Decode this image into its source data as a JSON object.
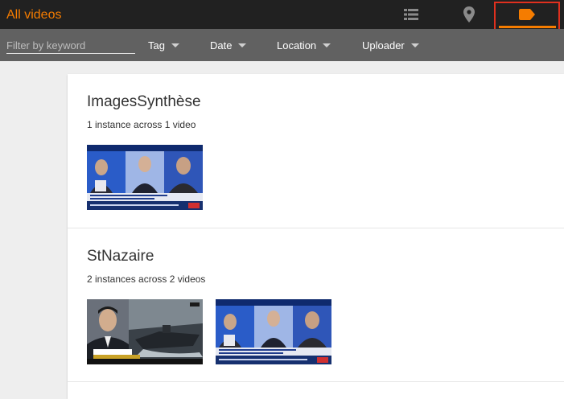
{
  "header": {
    "title": "All videos",
    "views": [
      {
        "name": "list-view",
        "icon": "list-icon"
      },
      {
        "name": "map-view",
        "icon": "map-pin-icon"
      },
      {
        "name": "tag-view",
        "icon": "tag-icon",
        "active": true
      }
    ],
    "accent_color": "#f57c00"
  },
  "filters": {
    "keyword_placeholder": "Filter by keyword",
    "keyword_value": "",
    "dropdowns": [
      "Tag",
      "Date",
      "Location",
      "Uploader"
    ]
  },
  "groups": [
    {
      "title": "ImagesSynthèse",
      "subtitle": "1 instance across 1 video",
      "thumbnails": [
        {
          "kind": "news-studio-panel"
        }
      ]
    },
    {
      "title": "StNazaire",
      "subtitle": "2 instances across 2 videos",
      "thumbnails": [
        {
          "kind": "news-anchor-ship",
          "caption": "HAN SHEZZAR"
        },
        {
          "kind": "news-studio-panel"
        }
      ]
    }
  ]
}
